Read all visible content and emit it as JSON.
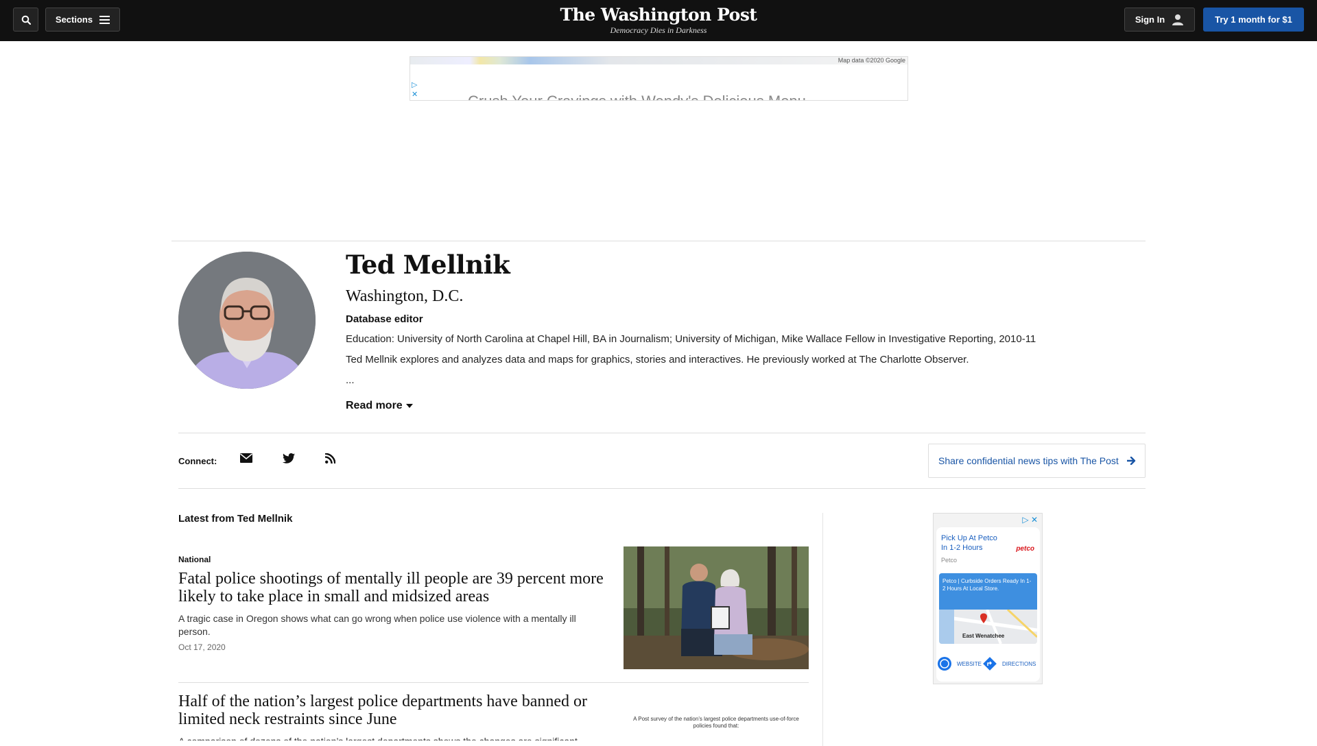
{
  "topbar": {
    "sections_label": "Sections",
    "masthead_name": "The Washington Post",
    "masthead_tagline": "Democracy Dies in Darkness",
    "signin_label": "Sign In",
    "subscribe_label": "Try 1 month for $1"
  },
  "top_ad": {
    "map_credit": "Map data ©2020 Google",
    "text": "Crush Your Cravings with Wendy's Delicious Menu"
  },
  "author": {
    "name": "Ted Mellnik",
    "location": "Washington, D.C.",
    "role": "Database editor",
    "education": "Education: University of North Carolina at Chapel Hill, BA in Journalism; University of Michigan, Mike Wallace Fellow in Investigative Reporting, 2010-11",
    "bio": "Ted Mellnik explores and analyzes data and maps for graphics, stories and interactives. He previously worked at The Charlotte Observer.",
    "ellipsis": "...",
    "read_more": "Read more"
  },
  "connect": {
    "label": "Connect:",
    "tips_label": "Share confidential news tips with The Post"
  },
  "latest": {
    "heading": "Latest from Ted Mellnik",
    "articles": [
      {
        "kicker": "National",
        "title": "Fatal police shootings of mentally ill people are 39 percent more likely to take place in small and midsized areas",
        "blurb": "A tragic case in Oregon shows what can go wrong when police use violence with a mentally ill person.",
        "date": "Oct 17, 2020"
      },
      {
        "title": "Half of the nation’s largest police departments have banned or limited neck restraints since June",
        "blurb": "A comparison of dozens of the nation’s largest departments shows the changes are significant.",
        "image_caption": "A Post survey of the nation’s largest police departments use-of-force policies found that:"
      }
    ]
  },
  "side_ad": {
    "headline": "Pick Up At Petco In 1-2 Hours",
    "brand_logo": "petco",
    "brand": "Petco",
    "promo": "Petco | Curbside Orders Ready In 1-2 Hours At Local Store.",
    "city": "East Wenatchee",
    "website_label": "WEBSITE",
    "directions_label": "DIRECTIONS"
  },
  "colors": {
    "topbar_bg": "#111111",
    "accent_blue": "#1955a5"
  }
}
